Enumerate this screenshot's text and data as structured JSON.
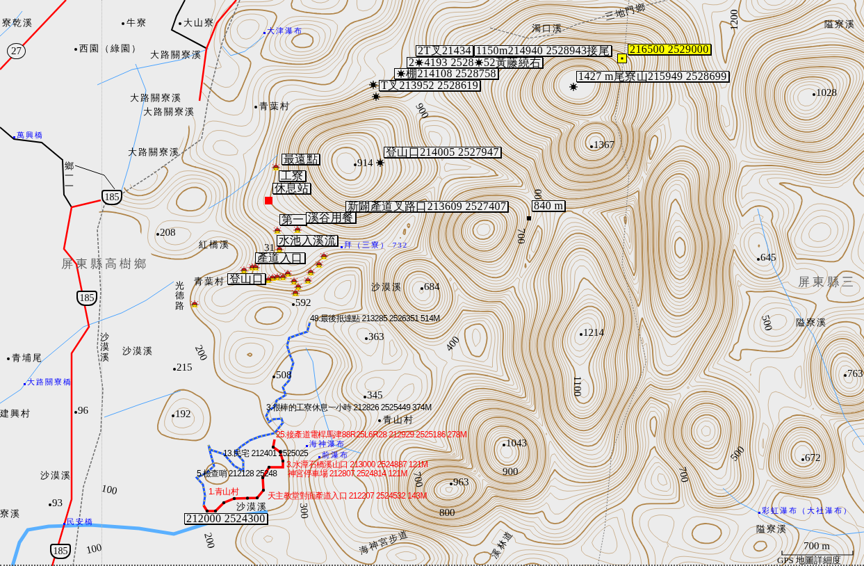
{
  "map_labels": [
    {
      "kind": "name",
      "text": "寮乾溪"
    },
    {
      "kind": "point",
      "text": "牛寮"
    },
    {
      "kind": "point",
      "text": "大山寮"
    },
    {
      "kind": "water",
      "text": "大津瀑布"
    },
    {
      "kind": "point",
      "text": "西園（綠園）"
    },
    {
      "kind": "name",
      "text": "大路關寮溪"
    },
    {
      "kind": "name",
      "text": "大路關寮溪"
    },
    {
      "kind": "name",
      "text": "大路關寮溪"
    },
    {
      "kind": "point",
      "text": "青葉村"
    },
    {
      "kind": "water",
      "text": "萬興橋"
    },
    {
      "kind": "name",
      "text": "大路關寮溪"
    },
    {
      "kind": "vertical",
      "text": "鄉一一"
    },
    {
      "kind": "height",
      "text": "208"
    },
    {
      "kind": "name",
      "text": "紅橋溪"
    },
    {
      "kind": "district",
      "text": "屏東縣高樹鄉"
    },
    {
      "kind": "name",
      "text": "青葉村"
    },
    {
      "kind": "vertical",
      "text": "光德路"
    },
    {
      "kind": "vertical",
      "text": "沙漠溪"
    },
    {
      "kind": "name",
      "text": "沙漠溪"
    },
    {
      "kind": "point",
      "text": "青埔尾"
    },
    {
      "kind": "water",
      "text": "大路關寮橋"
    },
    {
      "kind": "height",
      "text": "215"
    },
    {
      "kind": "contour",
      "text": "200"
    },
    {
      "kind": "name",
      "text": "建興村"
    },
    {
      "kind": "height",
      "text": "96"
    },
    {
      "kind": "height",
      "text": "192"
    },
    {
      "kind": "name",
      "text": "沙漠溪"
    },
    {
      "kind": "contour",
      "text": "100"
    },
    {
      "kind": "height",
      "text": "93"
    },
    {
      "kind": "name",
      "text": "寮溪"
    },
    {
      "kind": "water",
      "text": "民安橋"
    },
    {
      "kind": "contour",
      "text": "100"
    },
    {
      "kind": "contour",
      "text": "200"
    },
    {
      "kind": "contour",
      "text": "900"
    },
    {
      "kind": "name",
      "text": "濁口溪"
    },
    {
      "kind": "name",
      "text": "三地門鄉"
    },
    {
      "kind": "contour",
      "text": "1200"
    },
    {
      "kind": "name",
      "text": "隘寮溪"
    },
    {
      "kind": "height",
      "text": "1028"
    },
    {
      "kind": "height",
      "text": "914"
    },
    {
      "kind": "height",
      "text": "1367"
    },
    {
      "kind": "contour",
      "text": "00"
    },
    {
      "kind": "contour",
      "text": "700"
    },
    {
      "kind": "contour",
      "text": "31"
    },
    {
      "kind": "water",
      "text": "拜（三寮） 732"
    },
    {
      "kind": "name",
      "text": "沙漠溪"
    },
    {
      "kind": "height",
      "text": "684"
    },
    {
      "kind": "height",
      "text": "592"
    },
    {
      "kind": "track_black",
      "text": "48.最後抵達點 213285 2526351 514M"
    },
    {
      "kind": "height",
      "text": "363"
    },
    {
      "kind": "contour",
      "text": "400"
    },
    {
      "kind": "height",
      "text": "1214"
    },
    {
      "kind": "contour",
      "text": "1100"
    },
    {
      "kind": "height",
      "text": "508"
    },
    {
      "kind": "height",
      "text": "345"
    },
    {
      "kind": "track_black",
      "text": "3.很棒的工寮休息一小時 212826 2525449 374M"
    },
    {
      "kind": "point",
      "text": "青山村"
    },
    {
      "kind": "track_red",
      "text": "25.接產道電桿馬津88R25L6R28 212929 2525186 278M"
    },
    {
      "kind": "water",
      "text": "海神瀑布"
    },
    {
      "kind": "track_black",
      "text": "13.民宅 212401 2525025"
    },
    {
      "kind": "height",
      "text": "1043"
    },
    {
      "kind": "water",
      "text": "前瀑布"
    },
    {
      "kind": "track_red",
      "text": "3.水潭石橋溪山口 213000 2524887 121M"
    },
    {
      "kind": "track_black",
      "text": "5.檢查哨 212128 25248"
    },
    {
      "kind": "track_red",
      "text": "神宮停車場 212807 2524814 121M"
    },
    {
      "kind": "contour",
      "text": "700"
    },
    {
      "kind": "height",
      "text": "963"
    },
    {
      "kind": "contour",
      "text": "900"
    },
    {
      "kind": "track_red",
      "text": "1.青山村"
    },
    {
      "kind": "track_red",
      "text": "天主教堂對面產道入口 212207 2524532 143M"
    },
    {
      "kind": "name",
      "text": "沙漠溪"
    },
    {
      "kind": "contour",
      "text": "300"
    },
    {
      "kind": "contour",
      "text": "800"
    },
    {
      "kind": "name",
      "text": "海神宮步道"
    },
    {
      "kind": "name",
      "text": "溪林道"
    },
    {
      "kind": "height",
      "text": "645"
    },
    {
      "kind": "district",
      "text": "屏東縣三"
    },
    {
      "kind": "contour",
      "text": "500"
    },
    {
      "kind": "name",
      "text": "隘寮溪"
    },
    {
      "kind": "height",
      "text": "763"
    },
    {
      "kind": "contour",
      "text": "500"
    },
    {
      "kind": "height",
      "text": "672"
    },
    {
      "kind": "contour",
      "text": "700"
    },
    {
      "kind": "water",
      "text": "彩虹瀑布（大社瀑布）"
    },
    {
      "kind": "name",
      "text": "隘寮溪"
    }
  ],
  "waypoint_labels": [
    {
      "text": "最遠點",
      "highlighted": false
    },
    {
      "text": "工寮",
      "highlighted": false
    },
    {
      "text": "休息站",
      "highlighted": false
    },
    {
      "text": "第一",
      "highlighted": false
    },
    {
      "text": "溪谷用餐",
      "highlighted": false
    },
    {
      "text": "登山口214005 2527947",
      "highlighted": false
    },
    {
      "text": "新闢產道叉路口213609 2527407",
      "highlighted": false
    },
    {
      "text": "840 m",
      "highlighted": false
    },
    {
      "text": "水池入溪流",
      "highlighted": false
    },
    {
      "text": "產道入口",
      "highlighted": false
    },
    {
      "text": "登山口",
      "highlighted": false
    },
    {
      "text": "2T叉21434",
      "highlighted": false
    },
    {
      "text": "1150m214940 2528943接尾",
      "highlighted": false
    },
    {
      "text": "216500 2529000",
      "highlighted": true
    },
    {
      "parts": [
        "2",
        "4193 2528",
        "52黃藤繞右"
      ],
      "highlighted": false
    },
    {
      "text": "棚214108 2528758",
      "lead_marker": true,
      "highlighted": false
    },
    {
      "text": "T叉213952 2528619",
      "highlighted": false
    },
    {
      "text": "1427 m尾寮山215949 2528699",
      "highlighted": false
    },
    {
      "text": "212000 2524300",
      "highlighted": false
    }
  ],
  "route_shields": [
    {
      "kind": "circle",
      "text": "27"
    },
    {
      "kind": "shield",
      "text": "185"
    },
    {
      "kind": "shield",
      "text": "185"
    },
    {
      "kind": "shield",
      "text": "185"
    }
  ],
  "scale_bar": {
    "label": "700 m"
  },
  "status": {
    "text": "GPS 地圖詳細度"
  }
}
